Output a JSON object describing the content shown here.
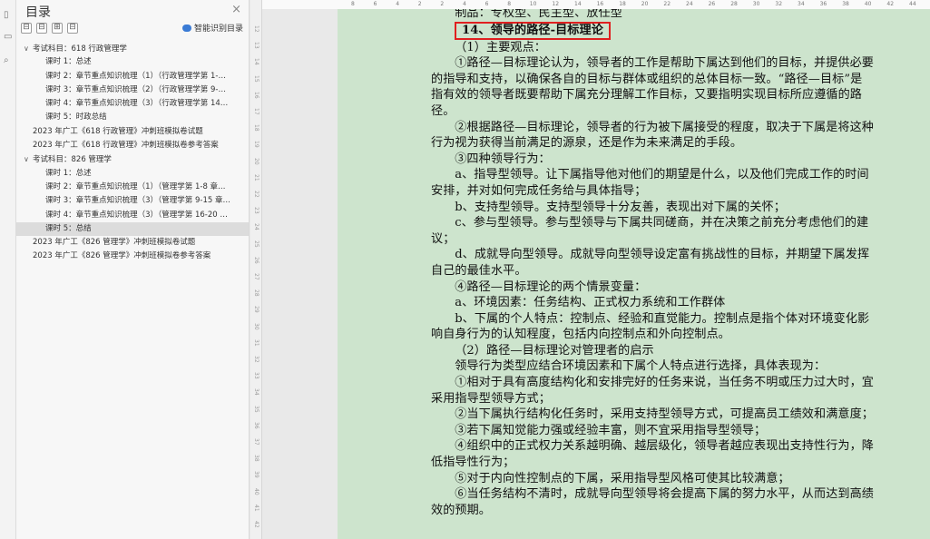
{
  "toc": {
    "title": "目录",
    "close": "×",
    "toolbar_buttons": [
      "⊟",
      "⊟",
      "⊞",
      "⊟"
    ],
    "smart_label": "智能识别目录",
    "items": [
      {
        "text": "考试科目：618 行政管理学",
        "level": 0,
        "caret": "∨"
      },
      {
        "text": "课时 1：总述",
        "level": 2
      },
      {
        "text": "课时 2：章节重点知识梳理（1）（行政管理学第 1-…",
        "level": 2
      },
      {
        "text": "课时 3：章节重点知识梳理（2）（行政管理学第 9-…",
        "level": 2
      },
      {
        "text": "课时 4：章节重点知识梳理（3）（行政管理学第 14…",
        "level": 2
      },
      {
        "text": "课时 5：时政总结",
        "level": 2
      },
      {
        "text": "2023 年广工《618 行政管理》冲刺班模拟卷试题",
        "level": 1
      },
      {
        "text": "2023 年广工《618 行政管理》冲刺班模拟卷参考答案",
        "level": 1
      },
      {
        "text": "考试科目：826 管理学",
        "level": 0,
        "caret": "∨"
      },
      {
        "text": "课时 1：总述",
        "level": 2
      },
      {
        "text": "课时 2：章节重点知识梳理（1）（管理学第 1-8 章…",
        "level": 2
      },
      {
        "text": "课时 3：章节重点知识梳理（3）（管理学第 9-15 章…",
        "level": 2
      },
      {
        "text": "课时 4：章节重点知识梳理（3）（管理学第 16-20 …",
        "level": 2
      },
      {
        "text": "课时 5：总结",
        "level": 2,
        "selected": true
      },
      {
        "text": "2023 年广工《826 管理学》冲刺班模拟卷试题",
        "level": 1
      },
      {
        "text": "2023 年广工《826 管理学》冲刺班模拟卷参考答案",
        "level": 1
      }
    ]
  },
  "ruler": {
    "top_marks": [
      "8",
      "6",
      "4",
      "2",
      "2",
      "4",
      "6",
      "8",
      "10",
      "12",
      "14",
      "16",
      "18",
      "20",
      "22",
      "24",
      "26",
      "28",
      "30",
      "32",
      "34",
      "36",
      "38",
      "40",
      "42",
      "44"
    ],
    "left_marks": [
      "12",
      "13",
      "14",
      "15",
      "16",
      "17",
      "18",
      "19",
      "20",
      "21",
      "22",
      "23",
      "24",
      "25",
      "26",
      "27",
      "28",
      "29",
      "30",
      "31",
      "32",
      "33",
      "34",
      "35",
      "36",
      "37",
      "38",
      "39",
      "40",
      "41",
      "42"
    ]
  },
  "doc": {
    "partial_top": "制品：专权型、民主型、放任型",
    "heading": "14、领导的路径-目标理论",
    "paragraphs": [
      "（1）主要观点：",
      "①路径—目标理论认为，领导者的工作是帮助下属达到他们的目标，并提供必要的指导和支持，以确保各自的目标与群体或组织的总体目标一致。“路径—目标”是指有效的领导者既要帮助下属充分理解工作目标，又要指明实现目标所应遵循的路径。",
      "②根据路径—目标理论，领导者的行为被下属接受的程度，取决于下属是将这种行为视为获得当前满足的源泉，还是作为未来满足的手段。",
      "③四种领导行为：",
      "a、指导型领导。让下属指导他对他们的期望是什么，以及他们完成工作的时间安排，并对如何完成任务给与具体指导；",
      "b、支持型领导。支持型领导十分友善，表现出对下属的关怀；",
      "c、参与型领导。参与型领导与下属共同磋商，并在决策之前充分考虑他们的建议；",
      "d、成就导向型领导。成就导向型领导设定富有挑战性的目标，并期望下属发挥自己的最佳水平。",
      "④路径—目标理论的两个情景变量：",
      "a、环境因素：任务结构、正式权力系统和工作群体",
      "b、下属的个人特点：控制点、经验和直觉能力。控制点是指个体对环境变化影响自身行为的认知程度，包括内向控制点和外向控制点。",
      "（2）路径—目标理论对管理者的启示",
      "领导行为类型应结合环境因素和下属个人特点进行选择，具体表现为：",
      "①相对于具有高度结构化和安排完好的任务来说，当任务不明或压力过大时，宜采用指导型领导方式；",
      "②当下属执行结构化任务时，采用支持型领导方式，可提高员工绩效和满意度；",
      "③若下属知觉能力强或经验丰富，则不宜采用指导型领导；",
      "④组织中的正式权力关系越明确、越层级化，领导者越应表现出支持性行为，降低指导性行为；",
      "⑤对于内向性控制点的下属，采用指导型风格可使其比较满意；",
      "⑥当任务结构不清时，成就导向型领导将会提高下属的努力水平，从而达到高绩效的预期。"
    ]
  },
  "colors": {
    "page_bg": "#cde4cd",
    "heading_box": "#e02020"
  }
}
